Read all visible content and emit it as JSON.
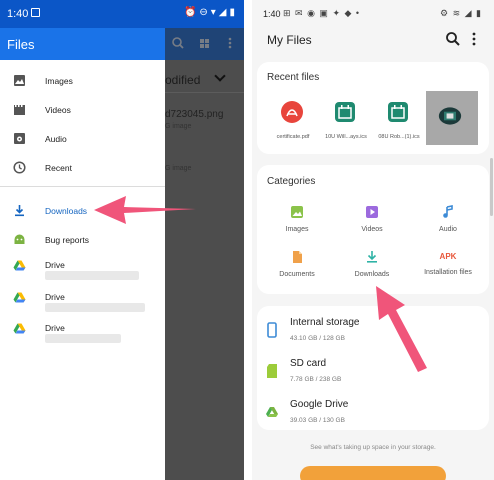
{
  "left_phone": {
    "status_bar": {
      "time": "1:40",
      "icons": "⏰⊖▾◢▮"
    },
    "background": {
      "modified_header": "odified",
      "file_name": "d723045.png",
      "file_type_1": "G image",
      "file_type_2": "G image"
    },
    "drawer": {
      "title": "Files",
      "items": [
        {
          "label": "Images",
          "icon": "image-icon"
        },
        {
          "label": "Videos",
          "icon": "video-icon"
        },
        {
          "label": "Audio",
          "icon": "audio-icon"
        },
        {
          "label": "Recent",
          "icon": "clock-icon"
        },
        {
          "label": "Downloads",
          "icon": "download-icon",
          "active": true
        },
        {
          "label": "Bug reports",
          "icon": "android-icon"
        },
        {
          "label": "Drive",
          "icon": "drive-icon"
        },
        {
          "label": "Drive",
          "icon": "drive-icon"
        },
        {
          "label": "Drive",
          "icon": "drive-icon"
        }
      ]
    }
  },
  "right_phone": {
    "status_bar": {
      "time": "1:40",
      "notifications": "⊞ ✉ ◉ ▣ ✦ ◆ •",
      "icons": "⚙ ≋ ◢ ▮"
    },
    "title": "My Files",
    "recent": {
      "title": "Recent files",
      "items": [
        {
          "caption": "certificate.pdf",
          "icon": "pdf-icon"
        },
        {
          "caption": "10U Will...ays.ics",
          "icon": "calendar-icon"
        },
        {
          "caption": "08U Rob...(1).ics",
          "icon": "calendar-icon"
        },
        {
          "caption": "",
          "icon": "image-thumb-icon"
        }
      ]
    },
    "categories": {
      "title": "Categories",
      "items": [
        {
          "label": "Images",
          "icon": "image-icon"
        },
        {
          "label": "Videos",
          "icon": "video-icon"
        },
        {
          "label": "Audio",
          "icon": "music-icon"
        },
        {
          "label": "Documents",
          "icon": "document-icon"
        },
        {
          "label": "Downloads",
          "icon": "download-icon"
        },
        {
          "label": "Installation files",
          "icon": "apk-icon",
          "icon_text": "APK"
        }
      ]
    },
    "storage": [
      {
        "name": "Internal storage",
        "size": "43.10 GB / 128 GB",
        "icon": "phone-icon"
      },
      {
        "name": "SD card",
        "size": "7.78 GB / 238 GB",
        "icon": "sd-card-icon"
      },
      {
        "name": "Google Drive",
        "size": "39.03 GB / 130 GB",
        "icon": "drive-icon"
      }
    ],
    "footer_note": "See what's taking up space in your storage."
  },
  "colors": {
    "accent_blue": "#1a73e8",
    "arrow_pink": "#f0557a",
    "apk_red": "#e8573b",
    "analyze_orange": "#f2a13a"
  }
}
